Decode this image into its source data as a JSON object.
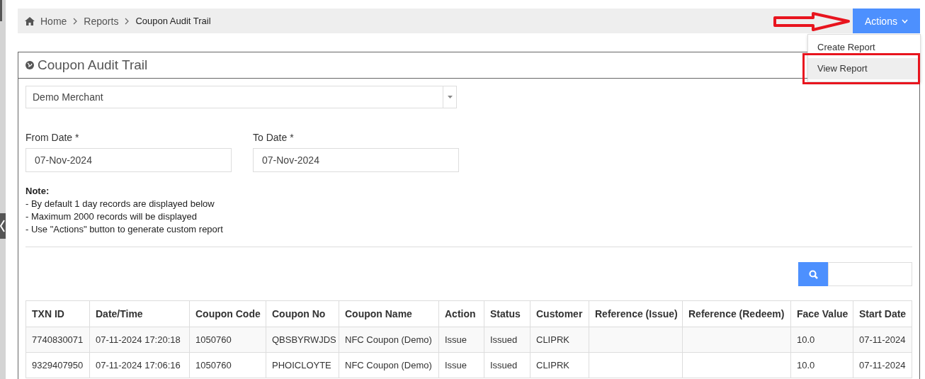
{
  "breadcrumb": [
    {
      "label": "Home",
      "kind": "home"
    },
    {
      "label": "Reports",
      "kind": "link"
    },
    {
      "label": "Coupon Audit Trail",
      "kind": "current"
    }
  ],
  "actions": {
    "label": "Actions",
    "expanded": true,
    "menu": [
      {
        "label": "Create Report",
        "selected": false
      },
      {
        "label": "View Report",
        "selected": true
      }
    ]
  },
  "panel": {
    "title": "Coupon Audit Trail",
    "merchant": {
      "value": "Demo Merchant"
    },
    "from_date": {
      "label": "From Date *",
      "value": "07-Nov-2024"
    },
    "to_date": {
      "label": "To Date *",
      "value": "07-Nov-2024"
    },
    "note": {
      "title": "Note:",
      "lines": [
        "- By default 1 day records are displayed below",
        "- Maximum 2000 records will be displayed",
        "- Use \"Actions\" button to generate custom report"
      ]
    },
    "table": {
      "columns": [
        "TXN ID",
        "Date/Time",
        "Coupon Code",
        "Coupon No",
        "Coupon Name",
        "Action",
        "Status",
        "Customer",
        "Reference (Issue)",
        "Reference (Redeem)",
        "Face Value",
        "Start Date"
      ],
      "rows": [
        [
          "7740830071",
          "07-11-2024 17:20:18",
          "1050760",
          "QBSBYRWJDS",
          "NFC Coupon (Demo)",
          "Issue",
          "Issued",
          "CLIPRK",
          "",
          "",
          "10.0",
          "07-11-2024"
        ],
        [
          "9329407950",
          "07-11-2024 17:06:16",
          "1050760",
          "PHOICLOYTE",
          "NFC Coupon (Demo)",
          "Issue",
          "Issued",
          "CLIPRK",
          "",
          "",
          "10.0",
          "07-11-2024"
        ]
      ]
    }
  }
}
